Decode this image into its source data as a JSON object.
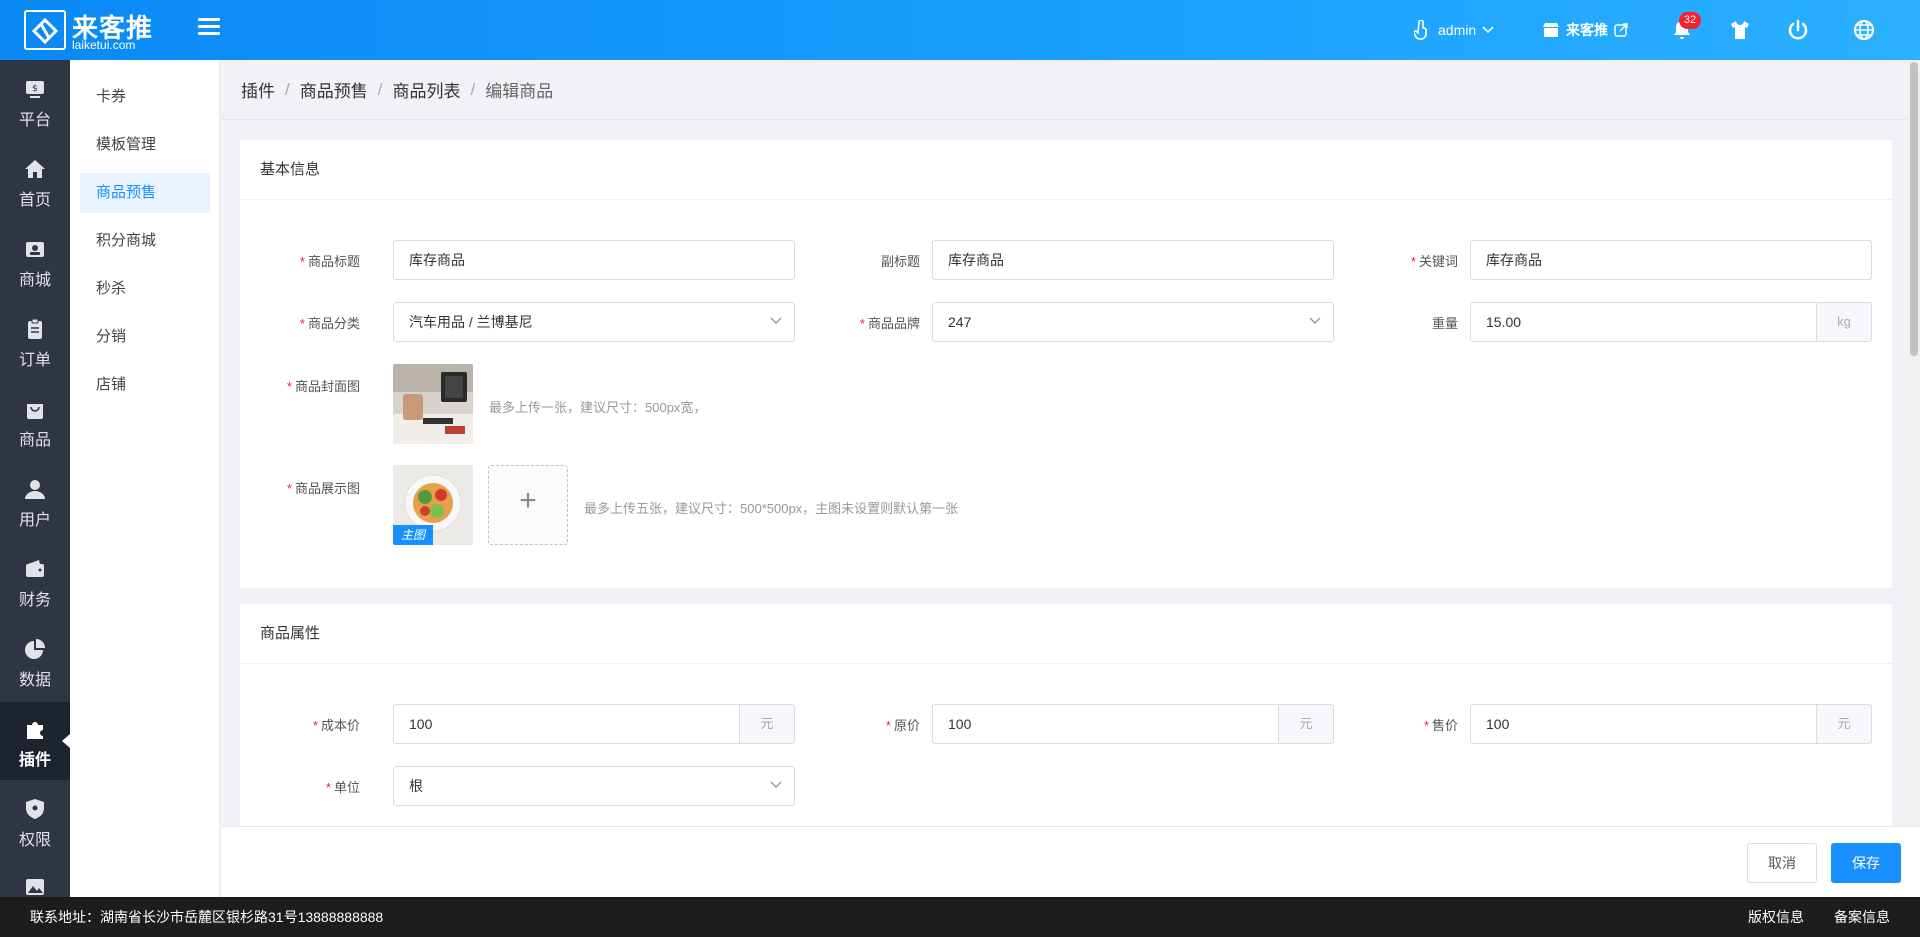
{
  "brand": {
    "name_cn": "来客推",
    "name_en": "laiketui.com"
  },
  "header": {
    "user": "admin",
    "store": "来客推",
    "notifications": "32",
    "colors": {
      "gradient_start": "#0a89f5",
      "gradient_end": "#2bb0ff"
    }
  },
  "sidebar": {
    "items": [
      {
        "label": "平台",
        "icon": "platform-icon"
      },
      {
        "label": "首页",
        "icon": "home-icon"
      },
      {
        "label": "商城",
        "icon": "mall-icon"
      },
      {
        "label": "订单",
        "icon": "order-icon"
      },
      {
        "label": "商品",
        "icon": "goods-icon"
      },
      {
        "label": "用户",
        "icon": "user-icon"
      },
      {
        "label": "财务",
        "icon": "wallet-icon"
      },
      {
        "label": "数据",
        "icon": "pie-chart-icon"
      },
      {
        "label": "插件",
        "icon": "puzzle-icon",
        "active": true
      },
      {
        "label": "权限",
        "icon": "shield-icon"
      },
      {
        "label": "",
        "icon": "image-icon"
      }
    ]
  },
  "submenu": {
    "items": [
      {
        "label": "卡券"
      },
      {
        "label": "模板管理"
      },
      {
        "label": "商品预售",
        "active": true
      },
      {
        "label": "积分商城"
      },
      {
        "label": "秒杀"
      },
      {
        "label": "分销"
      },
      {
        "label": "店铺"
      }
    ]
  },
  "breadcrumb": [
    "插件",
    "商品预售",
    "商品列表",
    "编辑商品"
  ],
  "basic": {
    "title": "基本信息",
    "product_title_label": "商品标题",
    "product_title_value": "库存商品",
    "subtitle_label": "副标题",
    "subtitle_value": "库存商品",
    "keyword_label": "关键词",
    "keyword_value": "库存商品",
    "category_label": "商品分类",
    "category_value": "汽车用品 / 兰博基尼",
    "brand_label": "商品品牌",
    "brand_value": "247",
    "weight_label": "重量",
    "weight_value": "15.00",
    "weight_unit": "kg",
    "cover_label": "商品封面图",
    "cover_hint": "最多上传一张，建议尺寸：500px宽，",
    "gallery_label": "商品展示图",
    "gallery_tag": "主图",
    "gallery_hint": "最多上传五张，建议尺寸：500*500px，主图未设置则默认第一张"
  },
  "attrs": {
    "title": "商品属性",
    "cost_label": "成本价",
    "cost_value": "100",
    "original_label": "原价",
    "original_value": "100",
    "price_label": "售价",
    "price_value": "100",
    "currency_unit": "元",
    "unit_label": "单位",
    "unit_value": "根"
  },
  "actions": {
    "cancel": "取消",
    "save": "保存"
  },
  "footer": {
    "address": "联系地址：湖南省长沙市岳麓区银杉路31号13888888888",
    "copyright": "版权信息",
    "icp": "备案信息"
  }
}
